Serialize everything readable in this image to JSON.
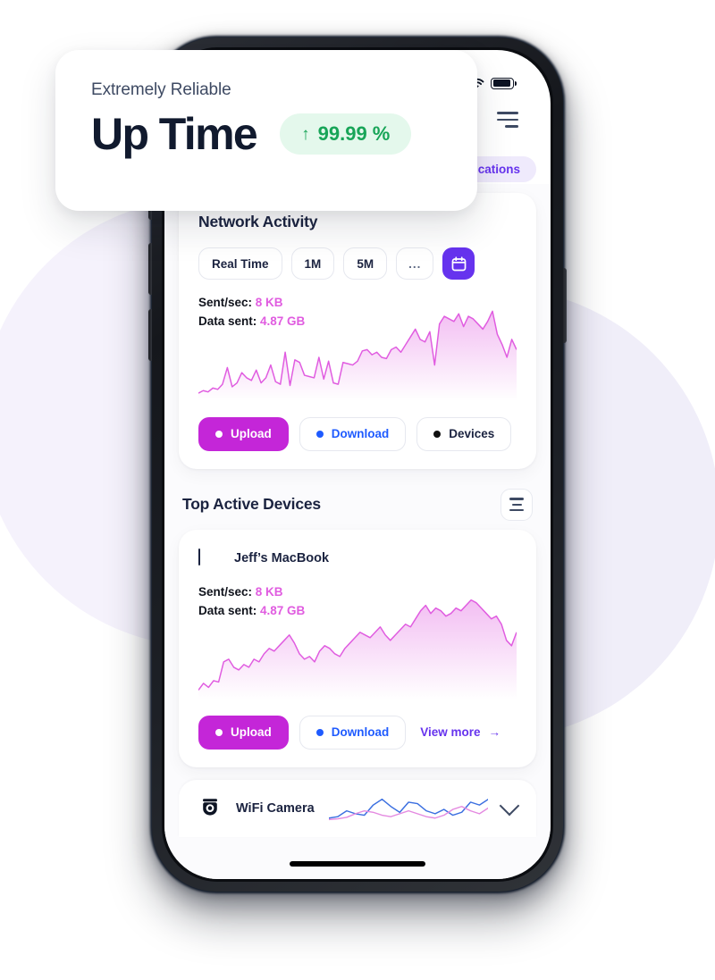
{
  "uptime_card": {
    "subtitle": "Extremely Reliable",
    "title": "Up Time",
    "badge_arrow": "↑",
    "badge_value": "99.99 %",
    "badge_color": "#18a558",
    "badge_bg": "#e4f8ec"
  },
  "status_bar": {
    "signal_icon": "cellular-signal-icon",
    "wifi_icon": "wifi-icon",
    "battery_icon": "battery-icon"
  },
  "header": {
    "menu_icon": "hamburger-menu-icon"
  },
  "nav": {
    "pills": [
      {
        "label": "Applications",
        "color": "#6633ee",
        "bg": "#efeafc"
      }
    ]
  },
  "network_card": {
    "title": "Network Activity",
    "ranges": [
      {
        "label": "Real Time",
        "active": false
      },
      {
        "label": "1M",
        "active": false
      },
      {
        "label": "5M",
        "active": false
      },
      {
        "label": "...",
        "active": false
      }
    ],
    "calendar_icon": "calendar-icon",
    "calendar_bg": "#6633ee",
    "stats": [
      {
        "label": "Sent/sec:",
        "value": "8 KB"
      },
      {
        "label": "Data sent:",
        "value": "4.87 GB"
      }
    ],
    "stat_value_color": "#e05ce0",
    "legend": [
      {
        "label": "Upload",
        "dot": "#ffffff",
        "bg": "#c426d8",
        "text": "#ffffff"
      },
      {
        "label": "Download",
        "dot": "#1f5bff",
        "bg": "#ffffff",
        "text": "#1f5bff"
      },
      {
        "label": "Devices",
        "dot": "#111111",
        "bg": "#ffffff",
        "text": "#1b2340"
      }
    ]
  },
  "devices_section": {
    "title": "Top Active Devices",
    "filter_icon": "filter-icon"
  },
  "device_card": {
    "icon": "macbook-icon",
    "name": "Jeff’s MacBook",
    "stats": [
      {
        "label": "Sent/sec:",
        "value": "8 KB"
      },
      {
        "label": "Data sent:",
        "value": "4.87 GB"
      }
    ],
    "legend": [
      {
        "label": "Upload",
        "dot": "#ffffff",
        "bg": "#c426d8",
        "text": "#ffffff"
      },
      {
        "label": "Download",
        "dot": "#1f5bff",
        "bg": "#ffffff",
        "text": "#1f5bff"
      }
    ],
    "view_more": "View more",
    "view_more_arrow": "→",
    "view_more_color": "#6633ee"
  },
  "collapsed_row": {
    "icon": "security-camera-icon",
    "label": "WiFi Camera",
    "chevron_icon": "chevron-down-icon"
  },
  "chart_data": [
    {
      "id": "network-activity-chart",
      "type": "area",
      "title": "Network Activity",
      "series": [
        {
          "name": "Upload",
          "color": "#e05ce0",
          "values": [
            2,
            4,
            3,
            6,
            5,
            9,
            22,
            7,
            10,
            18,
            14,
            12,
            20,
            10,
            14,
            24,
            11,
            9,
            34,
            8,
            28,
            26,
            16,
            15,
            14,
            30,
            13,
            27,
            10,
            9,
            26,
            25,
            24,
            27,
            35,
            36,
            32,
            34,
            30,
            29,
            36,
            38,
            34,
            40,
            46,
            52,
            44,
            42,
            50,
            24,
            56,
            62,
            60,
            58,
            64,
            54,
            62,
            60,
            56,
            52,
            58,
            66,
            48,
            40,
            30,
            44,
            36
          ]
        }
      ],
      "xlabel": "",
      "ylabel": "",
      "ylim": [
        0,
        70
      ],
      "grid": false,
      "legend": "bottom"
    },
    {
      "id": "jeffs-macbook-chart",
      "type": "area",
      "title": "Jeff’s MacBook",
      "series": [
        {
          "name": "Upload",
          "color": "#e05ce0",
          "values": [
            3,
            8,
            5,
            10,
            9,
            24,
            26,
            20,
            18,
            22,
            20,
            26,
            24,
            30,
            34,
            32,
            36,
            40,
            44,
            38,
            30,
            26,
            28,
            24,
            32,
            36,
            34,
            30,
            28,
            34,
            38,
            42,
            46,
            44,
            42,
            46,
            50,
            44,
            40,
            44,
            48,
            52,
            50,
            56,
            62,
            66,
            60,
            64,
            62,
            58,
            60,
            64,
            62,
            66,
            70,
            68,
            64,
            60,
            56,
            58,
            52,
            40,
            36,
            46
          ]
        }
      ],
      "xlabel": "",
      "ylabel": "",
      "ylim": [
        0,
        75
      ],
      "grid": false,
      "legend": "bottom"
    },
    {
      "id": "wifi-camera-mini-chart",
      "type": "line",
      "title": "WiFi Camera",
      "series": [
        {
          "name": "Download",
          "color": "#3b6fe0",
          "values": [
            4,
            6,
            14,
            10,
            8,
            22,
            30,
            20,
            12,
            26,
            24,
            14,
            10,
            16,
            8,
            12,
            26,
            22,
            30
          ]
        },
        {
          "name": "Upload",
          "color": "#e48ae0",
          "values": [
            2,
            3,
            5,
            10,
            14,
            12,
            8,
            6,
            10,
            14,
            10,
            6,
            4,
            8,
            16,
            20,
            14,
            10,
            18
          ]
        }
      ],
      "xlabel": "",
      "ylabel": "",
      "ylim": [
        0,
        32
      ],
      "grid": false,
      "legend": "none"
    }
  ]
}
